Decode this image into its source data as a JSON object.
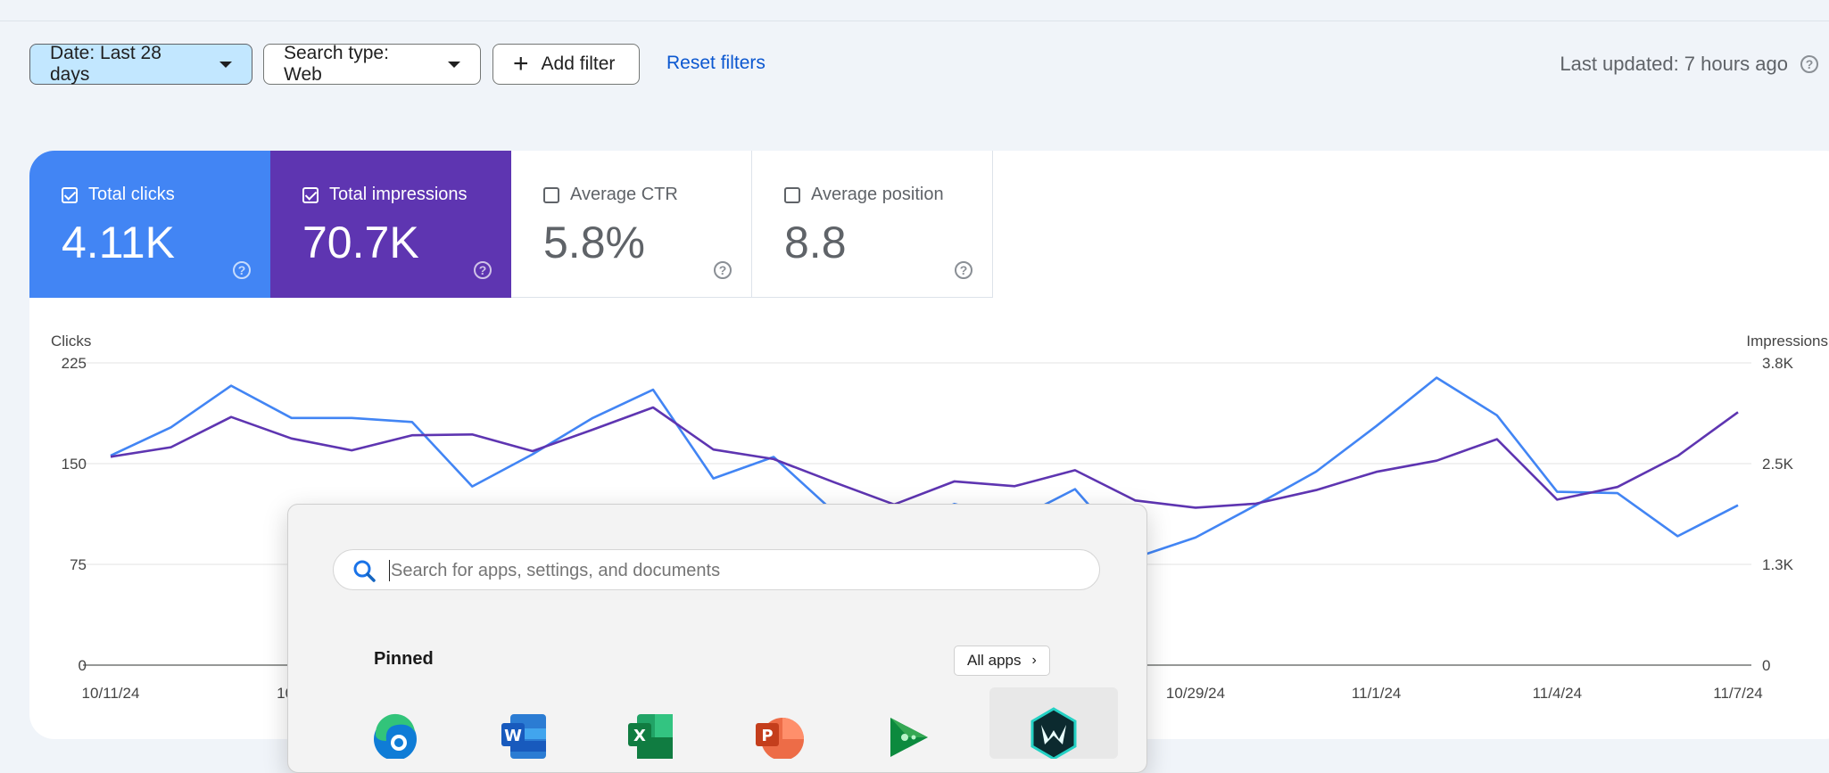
{
  "filters": {
    "date_label": "Date: Last 28 days",
    "search_type_label": "Search type: Web",
    "add_filter_label": "Add filter",
    "reset_label": "Reset filters"
  },
  "last_updated": "Last updated: 7 hours ago",
  "metrics": [
    {
      "label": "Total clicks",
      "value": "4.11K",
      "checked": true,
      "color": "#4285f4"
    },
    {
      "label": "Total impressions",
      "value": "70.7K",
      "checked": true,
      "color": "#5e35b1"
    },
    {
      "label": "Average CTR",
      "value": "5.8%",
      "checked": false
    },
    {
      "label": "Average position",
      "value": "8.8",
      "checked": false
    }
  ],
  "chart_data": {
    "type": "line",
    "ylabel_left": "Clicks",
    "ylabel_right": "Impressions",
    "y_left_ticks": [
      "225",
      "150",
      "75",
      "0"
    ],
    "y_right_ticks": [
      "3.8K",
      "2.5K",
      "1.3K",
      "0"
    ],
    "ylim_left": [
      0,
      225
    ],
    "ylim_right": [
      0,
      3800
    ],
    "x": [
      "10/11/24",
      "10/12/24",
      "10/13/24",
      "10/14/24",
      "10/15/24",
      "10/16/24",
      "10/17/24",
      "10/18/24",
      "10/19/24",
      "10/20/24",
      "10/21/24",
      "10/22/24",
      "10/23/24",
      "10/24/24",
      "10/25/24",
      "10/26/24",
      "10/27/24",
      "10/28/24",
      "10/29/24",
      "10/30/24",
      "10/31/24",
      "11/1/24",
      "11/2/24",
      "11/3/24",
      "11/4/24",
      "11/5/24",
      "11/6/24",
      "11/7/24"
    ],
    "x_tick_labels": [
      "10/11/24",
      "10/1",
      "",
      "",
      "10/29/24",
      "11/1/24",
      "11/4/24",
      "11/7/24"
    ],
    "series": [
      {
        "name": "Clicks",
        "axis": "left",
        "color": "#4285f4",
        "values": [
          156,
          177,
          208,
          184,
          184,
          181,
          133,
          157,
          184,
          205,
          139,
          155,
          114,
          100,
          120,
          108,
          131,
          80,
          95,
          119,
          144,
          178,
          214,
          186,
          129,
          128,
          96,
          119
        ]
      },
      {
        "name": "Impressions",
        "axis": "right",
        "color": "#5e35b1",
        "values": [
          2620,
          2740,
          3120,
          2850,
          2700,
          2890,
          2900,
          2690,
          2960,
          3240,
          2710,
          2590,
          2300,
          2020,
          2310,
          2250,
          2450,
          2070,
          1980,
          2030,
          2200,
          2430,
          2570,
          2840,
          2080,
          2240,
          2630,
          3180
        ]
      }
    ],
    "grid": true,
    "legend": "none"
  },
  "start_menu": {
    "search_placeholder": "Search for apps, settings, and documents",
    "pinned_label": "Pinned",
    "all_apps_label": "All apps",
    "apps": [
      "edge-icon",
      "word-icon",
      "excel-icon",
      "powerpoint-icon",
      "google-play-games-icon",
      "predator-sense-icon"
    ]
  }
}
